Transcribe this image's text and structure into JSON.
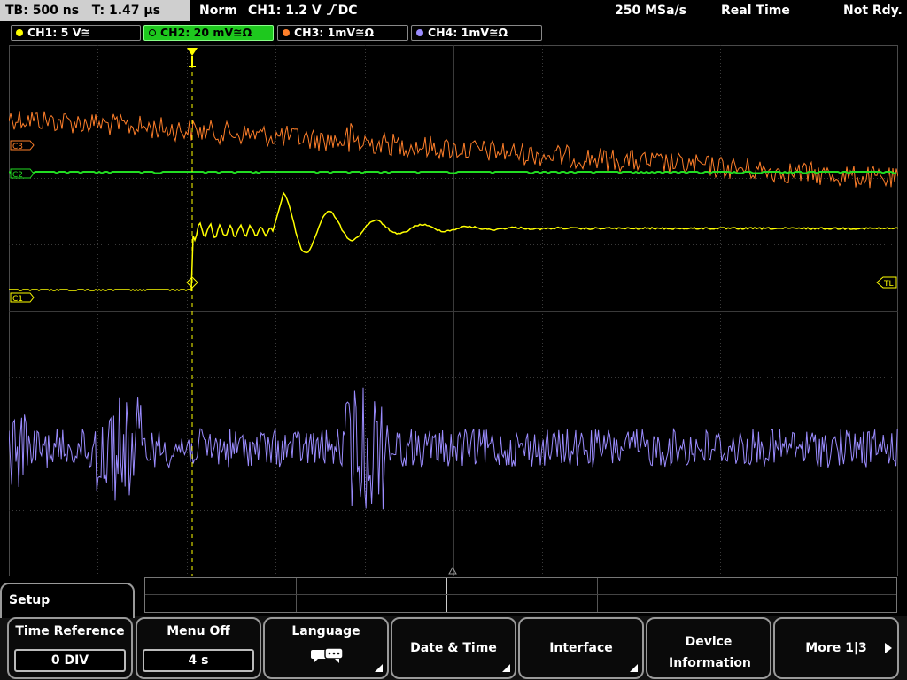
{
  "status": {
    "timebase": "TB: 500 ns",
    "trigger_time": "T: 1.47 µs",
    "trigger_mode": "Norm",
    "trigger_source": "CH1: 1.2 V",
    "trigger_coupling": "DC",
    "sample_rate": "250 MSa/s",
    "acquisition_mode": "Real Time",
    "run_state": "Not Rdy."
  },
  "channels": [
    {
      "label": "CH1: 5 V≅",
      "color": "#ffff00",
      "active": false
    },
    {
      "label": "CH2: 20 mV≅Ω",
      "color": "#22dd22",
      "active": true
    },
    {
      "label": "CH3: 1mV≅Ω",
      "color": "#ff7f2a",
      "active": false
    },
    {
      "label": "CH4: 1mV≅Ω",
      "color": "#9b8cff",
      "active": false
    }
  ],
  "markers": {
    "c1": "C1",
    "c2": "C2",
    "c3": "C3",
    "trigger_level": "TL"
  },
  "menu": {
    "title": "Setup",
    "softkeys": [
      {
        "label": "Time Reference",
        "value": "0 DIV"
      },
      {
        "label": "Menu Off",
        "value": "4 s"
      },
      {
        "label": "Language",
        "icon": "speech-bubbles-icon"
      },
      {
        "label": "Date & Time"
      },
      {
        "label": "Interface"
      },
      {
        "label": "Device Information"
      },
      {
        "label": "More 1|3"
      }
    ]
  },
  "colors": {
    "ch1": "#ffff00",
    "ch2": "#22dd22",
    "ch3": "#ff7f2a",
    "ch4": "#9b8cff",
    "grid": "#3a3a3a"
  }
}
